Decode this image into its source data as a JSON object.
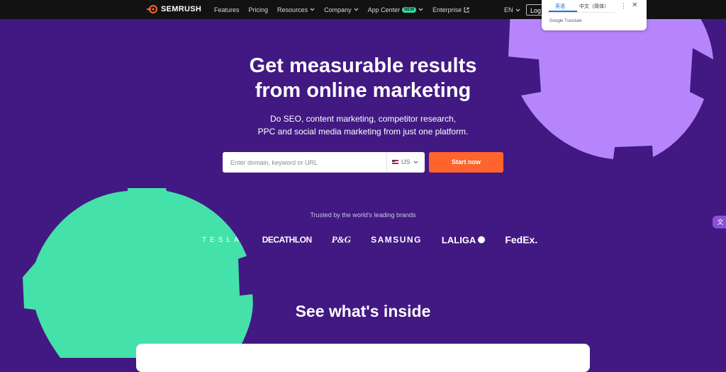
{
  "header": {
    "logo_text": "SEMRUSH",
    "nav": [
      {
        "label": "Features",
        "dropdown": false
      },
      {
        "label": "Pricing",
        "dropdown": false
      },
      {
        "label": "Resources",
        "dropdown": true
      },
      {
        "label": "Company",
        "dropdown": true
      },
      {
        "label": "App Center",
        "dropdown": true,
        "badge": "NEW"
      },
      {
        "label": "Enterprise",
        "external": true
      }
    ],
    "language": "EN",
    "login_label": "Log"
  },
  "hero": {
    "title_line1": "Get measurable results",
    "title_line2": "from online marketing",
    "subtitle_line1": "Do SEO, content marketing, competitor research,",
    "subtitle_line2": "PPC and social media marketing from just one platform."
  },
  "search": {
    "placeholder": "Enter domain, keyword or URL",
    "value": "",
    "country": "US",
    "start_label": "Start now"
  },
  "trusted": {
    "label": "Trusted by the world's leading brands",
    "brands": [
      "TESLA",
      "DECATHLON",
      "P&G",
      "SAMSUNG",
      "LALIGA",
      "FedEx."
    ]
  },
  "section": {
    "title": "See what's inside"
  },
  "translate_popup": {
    "tab_source": "英语",
    "tab_target": "中文（简体）",
    "footer_brand": "Google",
    "footer_text": "Translate"
  },
  "colors": {
    "background": "#421983",
    "topbar": "#121212",
    "accent_orange": "#ff642d",
    "deco_purple": "#b785fb",
    "deco_green": "#44e2aa"
  },
  "icons": {
    "logo": "semrush-fire-icon",
    "external": "external-link-icon",
    "chevron": "chevron-down-icon",
    "menu": "more-vert-icon",
    "close": "close-icon",
    "flag": "us-flag-icon",
    "side": "translate-widget-icon"
  }
}
